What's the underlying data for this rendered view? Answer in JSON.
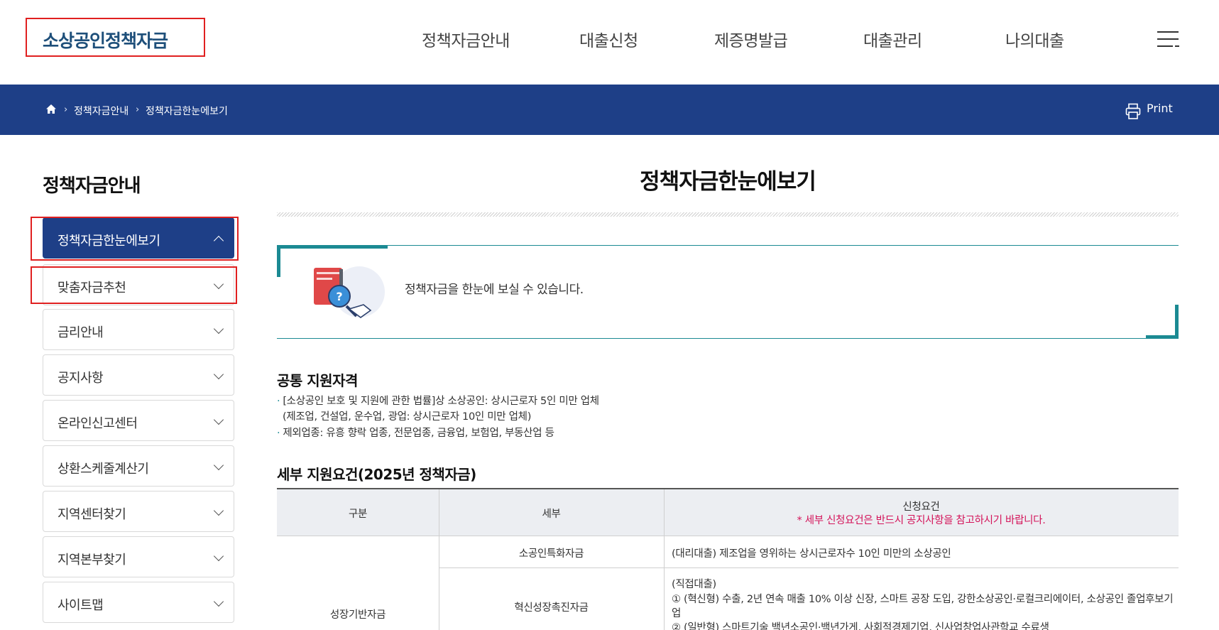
{
  "header": {
    "logo": "소상공인정책자금",
    "nav": [
      "정책자금안내",
      "대출신청",
      "제증명발급",
      "대출관리",
      "나의대출"
    ]
  },
  "breadcrumb": {
    "items": [
      "정책자금안내",
      "정책자금한눈에보기"
    ],
    "print_label": "Print"
  },
  "sidebar": {
    "title": "정책자금안내",
    "items": [
      {
        "label": "정책자금한눈에보기",
        "active": true
      },
      {
        "label": "맞춤자금추천"
      },
      {
        "label": "금리안내"
      },
      {
        "label": "공지사항"
      },
      {
        "label": "온라인신고센터"
      },
      {
        "label": "상환스케줄계산기"
      },
      {
        "label": "지역센터찾기"
      },
      {
        "label": "지역본부찾기"
      },
      {
        "label": "사이트맵"
      }
    ]
  },
  "main": {
    "title": "정책자금한눈에보기",
    "intro_text": "정책자금을 한눈에 보실 수 있습니다.",
    "common": {
      "title": "공통 지원자격",
      "lines": [
        "[소상공인 보호 및 지원에 관한 법률]상 소상공인: 상시근로자 5인 미만 업체",
        "(제조업, 건설업, 운수업, 광업: 상시근로자 10인 미만 업체)",
        "제외업종: 유흥 향락 업종, 전문업종, 금융업, 보험업, 부동산업 등"
      ]
    },
    "detail": {
      "title": "세부 지원요건(2025년 정책자금)",
      "headers": [
        "구분",
        "세부",
        "신청요건"
      ],
      "header_note": "* 세부 신청요건은 반드시 공지사항을 참고하시기 바랍니다.",
      "group": "성장기반자금",
      "rows": [
        {
          "name": "소공인특화자금",
          "lines": [
            "(대리대출) 제조업을 영위하는 상시근로자수 10인 미만의 소상공인"
          ]
        },
        {
          "name": "혁신성장촉진자금",
          "lines": [
            "(직접대출)",
            "① (혁신형) 수출, 2년 연속 매출 10% 이상 신장, 스마트 공장 도입, 강한소상공인·로컬크리에이터, 소상공인 졸업후보기",
            "업",
            "② (일반형) 스마트기술 백년소공인·백년가게, 사회적경제기업, 신사업창업사관학교 수료생"
          ]
        }
      ]
    }
  },
  "colors": {
    "band": "#1e3f87",
    "teal": "#1b8a93",
    "note": "#d4145a",
    "highlight": "#e02020"
  }
}
